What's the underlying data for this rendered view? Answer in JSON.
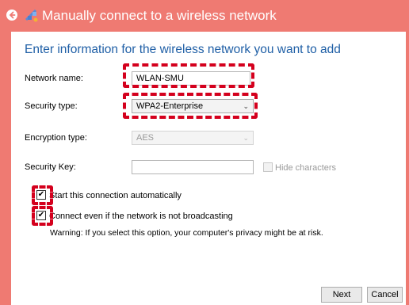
{
  "window": {
    "title": "Manually connect to a wireless network"
  },
  "form": {
    "heading": "Enter information for the wireless network you want to add",
    "network_name": {
      "label": "Network name:",
      "value": "WLAN-SMU"
    },
    "security_type": {
      "label": "Security type:",
      "value": "WPA2-Enterprise"
    },
    "encryption_type": {
      "label": "Encryption type:",
      "value": "AES"
    },
    "security_key": {
      "label": "Security Key:",
      "value": "",
      "hide_label": "Hide characters"
    },
    "start_auto": {
      "label": "Start this connection automatically",
      "checked": true
    },
    "connect_broadcast": {
      "label": "Connect even if the network is not broadcasting",
      "checked": true
    },
    "warning": "Warning: If you select this option, your computer's privacy might be at risk."
  },
  "buttons": {
    "next": "Next",
    "cancel": "Cancel"
  },
  "colors": {
    "title_bar": "#ef7a72",
    "heading": "#1f5fa6",
    "annotation": "#d4001d"
  },
  "icons": {
    "back": "back-arrow-icon",
    "network": "wireless-network-icon",
    "check": "checkmark-icon",
    "dropdown": "chevron-down-icon"
  }
}
